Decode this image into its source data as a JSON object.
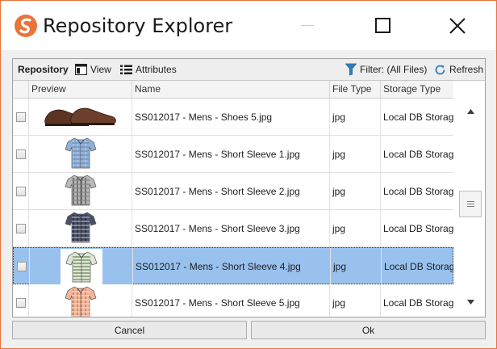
{
  "window": {
    "title": "Repository Explorer",
    "icons": {
      "logo": "app-logo-icon",
      "minimize": "minimize-icon",
      "maximize": "maximize-icon",
      "close": "close-icon"
    },
    "accent_color": "#e8743b"
  },
  "toolbar": {
    "repository_label": "Repository",
    "view_label": "View",
    "attributes_label": "Attributes",
    "filter_label": "Filter: (All Files)",
    "refresh_label": "Refresh",
    "filter_icon_color": "#2f7fc0",
    "refresh_icon_color": "#2f7fc0"
  },
  "grid": {
    "columns": [
      "",
      "Preview",
      "Name",
      "File Type",
      "Storage Type"
    ],
    "selection_color": "#99c1ee",
    "rows": [
      {
        "preview": "shoes-image",
        "name": "SS012017 - Mens - Shoes 5.jpg",
        "file_type": "jpg",
        "storage_type": "Local DB Storage",
        "selected": false,
        "checked": false
      },
      {
        "preview": "shirt-blue-image",
        "name": "SS012017 - Mens - Short Sleeve 1.jpg",
        "file_type": "jpg",
        "storage_type": "Local DB Storage",
        "selected": false,
        "checked": false
      },
      {
        "preview": "shirt-grey-plaid-image",
        "name": "SS012017 - Mens - Short Sleeve 2.jpg",
        "file_type": "jpg",
        "storage_type": "Local DB Storage",
        "selected": false,
        "checked": false
      },
      {
        "preview": "shirt-navy-plaid-image",
        "name": "SS012017 - Mens - Short Sleeve 3.jpg",
        "file_type": "jpg",
        "storage_type": "Local DB Storage",
        "selected": false,
        "checked": false
      },
      {
        "preview": "shirt-green-stripe-image",
        "name": "SS012017 - Mens - Short Sleeve 4.jpg",
        "file_type": "jpg",
        "storage_type": "Local DB Storage",
        "selected": true,
        "checked": false
      },
      {
        "preview": "shirt-orange-plaid-image",
        "name": "SS012017 - Mens - Short Sleeve 5.jpg",
        "file_type": "jpg",
        "storage_type": "Local DB Storage",
        "selected": false,
        "checked": false
      }
    ]
  },
  "buttons": {
    "cancel_label": "Cancel",
    "ok_label": "Ok"
  }
}
